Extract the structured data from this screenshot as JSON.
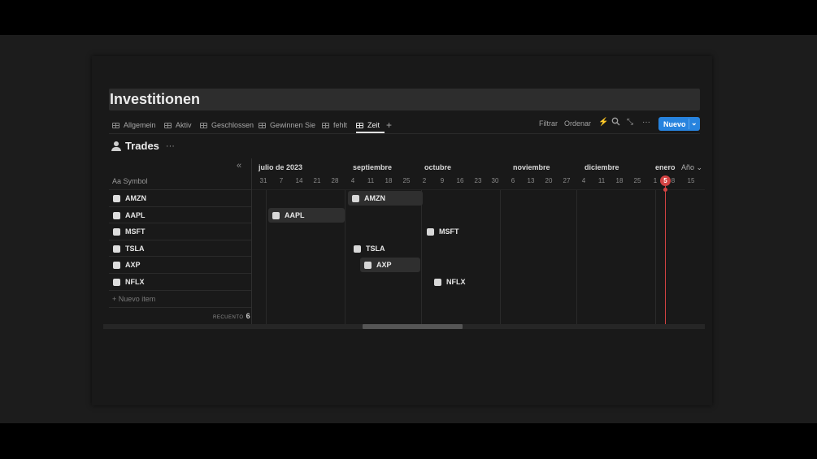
{
  "page_title": "Investitionen",
  "tabs": [
    {
      "label": "Allgemein",
      "icon": "table-icon"
    },
    {
      "label": "Aktiv",
      "icon": "table-icon"
    },
    {
      "label": "Geschlossen",
      "icon": "table-icon"
    },
    {
      "label": "Gewinnen Sie",
      "icon": "table-icon"
    },
    {
      "label": "fehlt",
      "icon": "table-icon"
    },
    {
      "label": "Zeit",
      "icon": "timeline-icon",
      "active": true
    }
  ],
  "add_tab_glyph": "+",
  "toolbar": {
    "filter_label": "Filtrar",
    "sort_label": "Ordenar",
    "automation_icon": "lightning-icon",
    "search_icon": "search-icon",
    "expand_icon": "expand-icon",
    "more_glyph": "···",
    "new_label": "Nuevo",
    "new_chevron": "⌄",
    "new_color": "#2783de"
  },
  "database": {
    "title": "Trades",
    "more_glyph": "···",
    "collapse_glyph": "«",
    "column_header": "Aa Symbol",
    "rows": [
      "AMZN",
      "AAPL",
      "MSFT",
      "TSLA",
      "AXP",
      "NFLX"
    ],
    "new_item_label": "+ Nuevo item",
    "count_label": "RECUENTO",
    "count_value": "6"
  },
  "timeline": {
    "months": [
      "julio de 2023",
      "septiembre",
      "octubre",
      "noviembre",
      "diciembre",
      "enero"
    ],
    "days": [
      "31",
      "7",
      "14",
      "21",
      "28",
      "4",
      "11",
      "18",
      "25",
      "2",
      "9",
      "16",
      "23",
      "30",
      "6",
      "13",
      "20",
      "27",
      "4",
      "11",
      "18",
      "25",
      "1",
      "8",
      "15"
    ],
    "view_selector": "Año ⌄",
    "today": "5",
    "today_color": "#d44343",
    "bars": [
      "AMZN",
      "AAPL",
      "MSFT",
      "TSLA",
      "AXP",
      "NFLX"
    ]
  }
}
